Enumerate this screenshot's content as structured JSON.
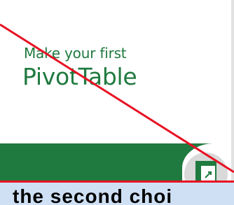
{
  "card": {
    "subtitle": "Make your first",
    "title": "PivotTable",
    "icon": "pivot-table-icon"
  },
  "bottom_bar": {
    "text": "the second choi"
  },
  "colors": {
    "brand_green": "#1f7a3f",
    "annotation_red": "#e81123",
    "bar_blue": "#cfe0f5"
  }
}
